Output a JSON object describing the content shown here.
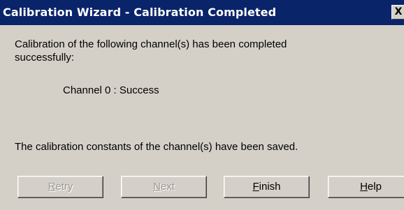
{
  "window": {
    "title": "Calibration Wizard - Calibration Completed",
    "close_label": "X"
  },
  "message": {
    "line1": "Calibration of the following channel(s) has been completed",
    "line2": "successfully:",
    "channel_status": "Channel 0 : Success",
    "saved": "The calibration constants of the channel(s) have been saved."
  },
  "buttons": {
    "retry": {
      "accel": "R",
      "rest": "etry",
      "enabled": false
    },
    "next": {
      "accel": "N",
      "rest": "ext",
      "enabled": false
    },
    "finish": {
      "accel": "F",
      "rest": "inish",
      "enabled": true
    },
    "help": {
      "accel": "H",
      "rest": "elp",
      "enabled": true
    }
  },
  "colors": {
    "titlebar": "#0a246a",
    "face": "#d4d0c8",
    "disabled_text": "#9c9a94"
  }
}
